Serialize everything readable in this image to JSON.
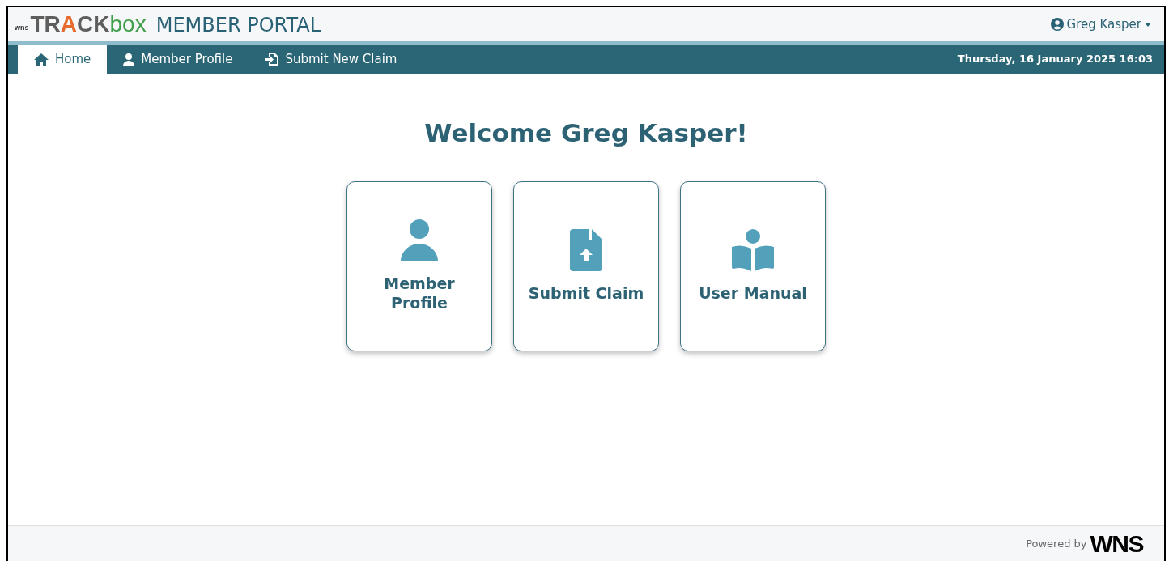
{
  "header": {
    "logo": {
      "prefix": "wns",
      "parts": [
        {
          "text": "TR",
          "color": "#5e5e5e"
        },
        {
          "text": "A",
          "color": "#e8692c"
        },
        {
          "text": "CK",
          "color": "#5e5e5e"
        },
        {
          "text": "box",
          "color": "#3f9f4a"
        }
      ]
    },
    "title": "MEMBER PORTAL",
    "user": "Greg Kasper"
  },
  "nav": {
    "tabs": [
      {
        "label": "Home",
        "selected": true
      },
      {
        "label": "Member Profile",
        "selected": false
      },
      {
        "label": "Submit New Claim",
        "selected": false
      }
    ],
    "datetime": "Thursday, 16 January 2025 16:03"
  },
  "welcome": "Welcome Greg Kasper!",
  "cards": [
    {
      "label": "Member Profile"
    },
    {
      "label": "Submit Claim"
    },
    {
      "label": "User Manual"
    }
  ],
  "footer": {
    "powered_by": "Powered by",
    "brand": "WNS"
  }
}
